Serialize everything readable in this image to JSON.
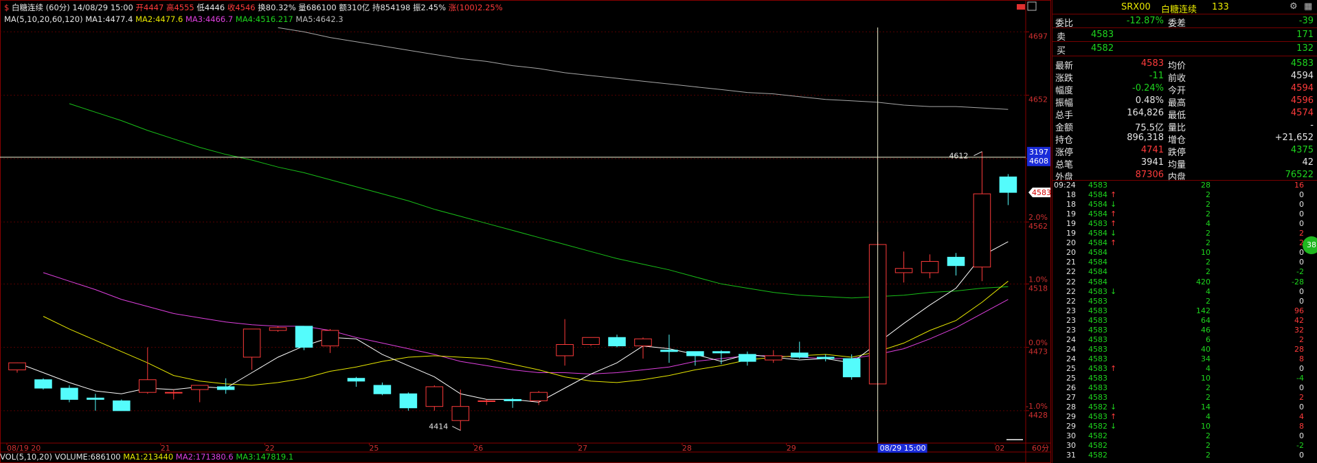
{
  "header": {
    "icon": "$",
    "name": "白糖连续",
    "period": "(60分)",
    "datetime": "14/08/29 15:00",
    "open": "开4447",
    "high": "高4555",
    "low": "低4446",
    "close": "收4546",
    "turnover": "换80.32%",
    "volume": "量686100",
    "amount": "额310亿",
    "open_interest": "持854198",
    "amplitude": "振2.45%",
    "change": "涨(100)2.25%"
  },
  "ma_header": {
    "params": "MA(5,10,20,60,120)",
    "ma1": "MA1:4477.4",
    "ma2": "MA2:4477.6",
    "ma3": "MA3:4466.7",
    "ma4": "MA4:4516.217",
    "ma5": "MA5:4642.3"
  },
  "vol_header": {
    "params": "VOL(5,10,20)",
    "volume": "VOLUME:686100",
    "ma1": "MA1:213440",
    "ma2": "MA2:171380.6",
    "ma3": "MA3:147819.1"
  },
  "colors": {
    "up": "#ff3b3b",
    "down": "#54fcfc",
    "ma1": "#ffffff",
    "ma2": "#e8e800",
    "ma3": "#e040e0",
    "ma4": "#18c018",
    "ma5": "#a8a8a8"
  },
  "chart_data": {
    "type": "candlestick",
    "y_axis": [
      {
        "pct": "",
        "price": "4697"
      },
      {
        "pct": "",
        "price": "4652"
      },
      {
        "pct": "",
        "price": "4607"
      },
      {
        "pct": "2.0%",
        "price": "4562"
      },
      {
        "pct": "1.0%",
        "price": "4518"
      },
      {
        "pct": "0.0%",
        "price": "4473"
      },
      {
        "pct": "-1.0%",
        "price": "4428"
      }
    ],
    "ylim": [
      4405,
      4705
    ],
    "x_labels": [
      "08/19 20",
      "21",
      "22",
      "25",
      "26",
      "27",
      "28",
      "29",
      "02"
    ],
    "x_label_slots": [
      0,
      5.5,
      9.5,
      13.5,
      17.5,
      21.5,
      25.5,
      29.5,
      37.5
    ],
    "candles": [
      {
        "o": 4457,
        "h": 4462,
        "l": 4455,
        "c": 4462
      },
      {
        "o": 4450,
        "h": 4451,
        "l": 4443,
        "c": 4444
      },
      {
        "o": 4444,
        "h": 4446,
        "l": 4434,
        "c": 4436
      },
      {
        "o": 4437,
        "h": 4440,
        "l": 4428,
        "c": 4436
      },
      {
        "o": 4435,
        "h": 4436,
        "l": 4428,
        "c": 4428
      },
      {
        "o": 4441,
        "h": 4473,
        "l": 4440,
        "c": 4450
      },
      {
        "o": 4441,
        "h": 4443,
        "l": 4436,
        "c": 4441
      },
      {
        "o": 4443,
        "h": 4446,
        "l": 4434,
        "c": 4446
      },
      {
        "o": 4445,
        "h": 4451,
        "l": 4440,
        "c": 4443
      },
      {
        "o": 4466,
        "h": 4486,
        "l": 4457,
        "c": 4486
      },
      {
        "o": 4485,
        "h": 4488,
        "l": 4484,
        "c": 4487
      },
      {
        "o": 4488,
        "h": 4487,
        "l": 4471,
        "c": 4473
      },
      {
        "o": 4474,
        "h": 4486,
        "l": 4469,
        "c": 4485
      },
      {
        "o": 4451,
        "h": 4452,
        "l": 4445,
        "c": 4449
      },
      {
        "o": 4446,
        "h": 4448,
        "l": 4439,
        "c": 4440
      },
      {
        "o": 4440,
        "h": 4441,
        "l": 4428,
        "c": 4430
      },
      {
        "o": 4431,
        "h": 4446,
        "l": 4428,
        "c": 4445
      },
      {
        "o": 4421,
        "h": 4443,
        "l": 4414,
        "c": 4431
      },
      {
        "o": 4435,
        "h": 4436,
        "l": 4432,
        "c": 4435
      },
      {
        "o": 4436,
        "h": 4437,
        "l": 4430,
        "c": 4435
      },
      {
        "o": 4435,
        "h": 4442,
        "l": 4432,
        "c": 4441
      },
      {
        "o": 4467,
        "h": 4493,
        "l": 4460,
        "c": 4475
      },
      {
        "o": 4475,
        "h": 4480,
        "l": 4474,
        "c": 4480
      },
      {
        "o": 4480,
        "h": 4482,
        "l": 4473,
        "c": 4474
      },
      {
        "o": 4474,
        "h": 4480,
        "l": 4465,
        "c": 4479
      },
      {
        "o": 4471,
        "h": 4482,
        "l": 4462,
        "c": 4470
      },
      {
        "o": 4470,
        "h": 4470,
        "l": 4460,
        "c": 4467
      },
      {
        "o": 4470,
        "h": 4471,
        "l": 4461,
        "c": 4469
      },
      {
        "o": 4468,
        "h": 4470,
        "l": 4460,
        "c": 4463
      },
      {
        "o": 4464,
        "h": 4471,
        "l": 4462,
        "c": 4467
      },
      {
        "o": 4469,
        "h": 4477,
        "l": 4465,
        "c": 4466
      },
      {
        "o": 4466,
        "h": 4468,
        "l": 4463,
        "c": 4465
      },
      {
        "o": 4465,
        "h": 4468,
        "l": 4450,
        "c": 4452
      },
      {
        "o": 4447,
        "h": 4555,
        "l": 4446,
        "c": 4546
      },
      {
        "o": 4526,
        "h": 4541,
        "l": 4519,
        "c": 4529
      },
      {
        "o": 4526,
        "h": 4539,
        "l": 4522,
        "c": 4534
      },
      {
        "o": 4537,
        "h": 4540,
        "l": 4524,
        "c": 4531
      },
      {
        "o": 4530,
        "h": 4612,
        "l": 4520,
        "c": 4582
      },
      {
        "o": 4594,
        "h": 4596,
        "l": 4574,
        "c": 4583
      }
    ],
    "ma_lines": {
      "ma1": [
        4462,
        4455,
        4448,
        4442,
        4440,
        4444,
        4443,
        4445,
        4444,
        4455,
        4466,
        4474,
        4480,
        4479,
        4468,
        4460,
        4452,
        4440,
        4436,
        4436,
        4434,
        4444,
        4454,
        4462,
        4474,
        4472,
        4468,
        4463,
        4468,
        4466,
        4464,
        4465,
        4462,
        4476,
        4490,
        4503,
        4515,
        4538,
        4548
      ],
      "ma2": [
        4495,
        4486,
        4478,
        4470,
        4462,
        4453,
        4449,
        4447,
        4446,
        4448,
        4451,
        4456,
        4459,
        4463,
        4466,
        4467,
        4466,
        4465,
        4461,
        4457,
        4452,
        4449,
        4448,
        4450,
        4453,
        4457,
        4460,
        4464,
        4466,
        4467,
        4468,
        4466,
        4470,
        4476,
        4485,
        4492,
        4505,
        4520
      ],
      "ma3": [
        4526,
        4520,
        4514,
        4507,
        4502,
        4497,
        4494,
        4491,
        4489,
        4488,
        4488,
        4485,
        4480,
        4476,
        4472,
        4468,
        4463,
        4460,
        4457,
        4455,
        4455,
        4454,
        4455,
        4457,
        4459,
        4463,
        4465,
        4467,
        4467,
        4466,
        4465,
        4465,
        4468,
        4472,
        4479,
        4487,
        4497,
        4507
      ],
      "ma4": [
        4646,
        4640,
        4634,
        4627,
        4621,
        4615,
        4610,
        4606,
        4601,
        4597,
        4592,
        4587,
        4582,
        4577,
        4571,
        4566,
        4561,
        4556,
        4551,
        4546,
        4541,
        4536,
        4532,
        4528,
        4523,
        4518,
        4515,
        4512,
        4510,
        4509,
        4508,
        4509,
        4510,
        4512,
        4513,
        4515,
        4516
      ],
      "ma5": [
        4700,
        4697,
        4693,
        4690,
        4687,
        4684,
        4681,
        4678,
        4676,
        4673,
        4671,
        4668,
        4666,
        4664,
        4662,
        4660,
        4658,
        4656,
        4654,
        4653,
        4651,
        4649,
        4648,
        4647,
        4645,
        4644,
        4644,
        4643,
        4642
      ]
    },
    "annotations": [
      {
        "label": "4612"
      },
      {
        "label": "4414"
      }
    ],
    "crosshair": {
      "price_label": "4608",
      "extra_label": "3197",
      "time_label": "08/29 15:00"
    },
    "last_price_label": "4583",
    "period_label": "60分"
  },
  "panel": {
    "title": {
      "code": "SRX00",
      "name": "白糖连续",
      "num": "133"
    },
    "committee": {
      "label1": "委比",
      "val1": "-12.87%",
      "label2": "委差",
      "val2": "-39"
    },
    "sell": {
      "label": "卖",
      "price": "4583",
      "vol": "171"
    },
    "buy": {
      "label": "买",
      "price": "4582",
      "vol": "132"
    },
    "stats": [
      {
        "l1": "最新",
        "v1": "4583",
        "c1": "red",
        "l2": "均价",
        "v2": "4583",
        "c2": "green"
      },
      {
        "l1": "涨跌",
        "v1": "-11",
        "c1": "green",
        "l2": "前收",
        "v2": "4594",
        "c2": "white"
      },
      {
        "l1": "幅度",
        "v1": "-0.24%",
        "c1": "green",
        "l2": "今开",
        "v2": "4594",
        "c2": "red"
      },
      {
        "l1": "振幅",
        "v1": "0.48%",
        "c1": "white",
        "l2": "最高",
        "v2": "4596",
        "c2": "red"
      },
      {
        "l1": "总手",
        "v1": "164,826",
        "c1": "white",
        "l2": "最低",
        "v2": "4574",
        "c2": "red"
      },
      {
        "l1": "金额",
        "v1": "75.5亿",
        "c1": "white",
        "l2": "量比",
        "v2": "-",
        "c2": "white"
      },
      {
        "l1": "持仓",
        "v1": "896,318",
        "c1": "white",
        "l2": "增仓",
        "v2": "+21,652",
        "c2": "white"
      },
      {
        "l1": "涨停",
        "v1": "4741",
        "c1": "red",
        "l2": "跌停",
        "v2": "4375",
        "c2": "green"
      },
      {
        "l1": "总笔",
        "v1": "3941",
        "c1": "white",
        "l2": "均量",
        "v2": "42",
        "c2": "white"
      },
      {
        "l1": "外盘",
        "v1": "87306",
        "c1": "red",
        "l2": "内盘",
        "v2": "76522",
        "c2": "green"
      }
    ],
    "ticks": [
      {
        "t": "09:24",
        "p": "4583",
        "a": "",
        "v": "28",
        "d": "16",
        "dc": "red",
        "pc": "green"
      },
      {
        "t": "18",
        "p": "4584",
        "a": "↑",
        "v": "2",
        "d": "0",
        "dc": "white",
        "pc": "green"
      },
      {
        "t": "18",
        "p": "4584",
        "a": "↓",
        "v": "2",
        "d": "0",
        "dc": "white",
        "pc": "green"
      },
      {
        "t": "19",
        "p": "4584",
        "a": "↑",
        "v": "2",
        "d": "0",
        "dc": "white",
        "pc": "green"
      },
      {
        "t": "19",
        "p": "4583",
        "a": "↑",
        "v": "4",
        "d": "0",
        "dc": "white",
        "pc": "green"
      },
      {
        "t": "19",
        "p": "4584",
        "a": "↓",
        "v": "2",
        "d": "2",
        "dc": "red",
        "pc": "green"
      },
      {
        "t": "20",
        "p": "4584",
        "a": "↑",
        "v": "2",
        "d": "2",
        "dc": "red",
        "pc": "green"
      },
      {
        "t": "20",
        "p": "4584",
        "a": "",
        "v": "10",
        "d": "0",
        "dc": "white",
        "pc": "green"
      },
      {
        "t": "21",
        "p": "4584",
        "a": "",
        "v": "2",
        "d": "0",
        "dc": "white",
        "pc": "green"
      },
      {
        "t": "22",
        "p": "4584",
        "a": "",
        "v": "2",
        "d": "-2",
        "dc": "green",
        "pc": "green"
      },
      {
        "t": "22",
        "p": "4584",
        "a": "",
        "v": "420",
        "d": "-28",
        "dc": "green",
        "pc": "green"
      },
      {
        "t": "22",
        "p": "4583",
        "a": "↓",
        "v": "4",
        "d": "0",
        "dc": "white",
        "pc": "green"
      },
      {
        "t": "22",
        "p": "4583",
        "a": "",
        "v": "2",
        "d": "0",
        "dc": "white",
        "pc": "green"
      },
      {
        "t": "23",
        "p": "4583",
        "a": "",
        "v": "142",
        "d": "96",
        "dc": "red",
        "pc": "green"
      },
      {
        "t": "23",
        "p": "4583",
        "a": "",
        "v": "64",
        "d": "42",
        "dc": "red",
        "pc": "green"
      },
      {
        "t": "23",
        "p": "4583",
        "a": "",
        "v": "46",
        "d": "32",
        "dc": "red",
        "pc": "green"
      },
      {
        "t": "24",
        "p": "4583",
        "a": "",
        "v": "6",
        "d": "2",
        "dc": "red",
        "pc": "green"
      },
      {
        "t": "24",
        "p": "4583",
        "a": "",
        "v": "40",
        "d": "28",
        "dc": "red",
        "pc": "green"
      },
      {
        "t": "24",
        "p": "4583",
        "a": "",
        "v": "34",
        "d": "8",
        "dc": "red",
        "pc": "green"
      },
      {
        "t": "25",
        "p": "4583",
        "a": "↑",
        "v": "4",
        "d": "0",
        "dc": "white",
        "pc": "green"
      },
      {
        "t": "25",
        "p": "4583",
        "a": "",
        "v": "10",
        "d": "-4",
        "dc": "green",
        "pc": "green"
      },
      {
        "t": "26",
        "p": "4583",
        "a": "",
        "v": "2",
        "d": "0",
        "dc": "white",
        "pc": "green"
      },
      {
        "t": "27",
        "p": "4583",
        "a": "",
        "v": "2",
        "d": "2",
        "dc": "red",
        "pc": "green"
      },
      {
        "t": "28",
        "p": "4582",
        "a": "↓",
        "v": "14",
        "d": "0",
        "dc": "white",
        "pc": "green"
      },
      {
        "t": "29",
        "p": "4583",
        "a": "↑",
        "v": "4",
        "d": "4",
        "dc": "red",
        "pc": "green"
      },
      {
        "t": "29",
        "p": "4582",
        "a": "↓",
        "v": "10",
        "d": "8",
        "dc": "red",
        "pc": "green"
      },
      {
        "t": "30",
        "p": "4582",
        "a": "",
        "v": "2",
        "d": "0",
        "dc": "white",
        "pc": "green"
      },
      {
        "t": "30",
        "p": "4582",
        "a": "",
        "v": "2",
        "d": "-2",
        "dc": "green",
        "pc": "green"
      },
      {
        "t": "31",
        "p": "4582",
        "a": "",
        "v": "2",
        "d": "0",
        "dc": "white",
        "pc": "green"
      }
    ],
    "badge": "38"
  }
}
